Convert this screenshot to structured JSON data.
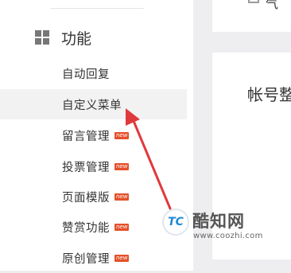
{
  "sidebar": {
    "section_title": "功能",
    "items": [
      {
        "label": "自动回复",
        "badge": ""
      },
      {
        "label": "自定义菜单",
        "badge": "",
        "selected": true
      },
      {
        "label": "留言管理",
        "badge": "new"
      },
      {
        "label": "投票管理",
        "badge": "new"
      },
      {
        "label": "页面模版",
        "badge": "new"
      },
      {
        "label": "赞赏功能",
        "badge": "new"
      },
      {
        "label": "原创管理",
        "badge": "new"
      }
    ]
  },
  "content": {
    "top_fragment": "气",
    "account_label": "帐号整"
  },
  "watermark": {
    "logo_text": "TC",
    "name": "酷知网",
    "url": "www.coozhi.com"
  },
  "colors": {
    "accent_badge": "#e4502a",
    "arrow": "#e0393c",
    "selected_bg": "#f2f2f3"
  }
}
